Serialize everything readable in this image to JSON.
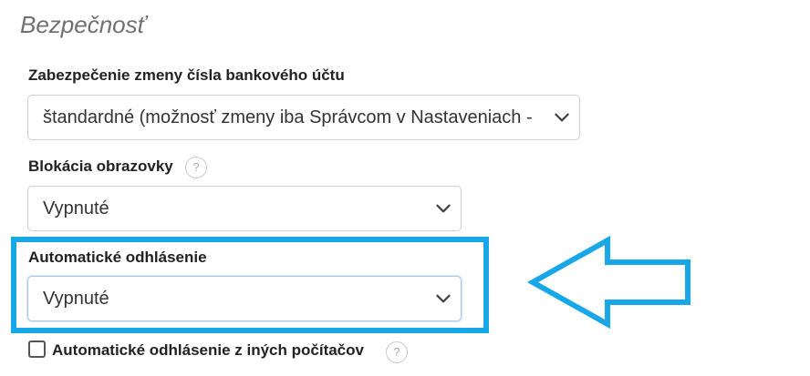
{
  "section": {
    "title": "Bezpečnosť"
  },
  "fields": {
    "bank_account_change": {
      "label": "Zabezpečenie zmeny čísla bankového účtu",
      "value": "štandardné (možnosť zmeny iba Správcom v Nastaveniach - "
    },
    "screen_lock": {
      "label": "Blokácia obrazovky",
      "value": "Vypnuté",
      "help": "?"
    },
    "auto_logout": {
      "label": "Automatické odhlásenie",
      "value": "Vypnuté"
    },
    "auto_logout_other": {
      "label": "Automatické odhlásenie z iných počítačov",
      "help": "?",
      "checked": false
    }
  },
  "icons": {
    "chevron": "chevron-down-icon",
    "help": "question-circle-icon",
    "arrow": "left-arrow-callout-icon"
  },
  "colors": {
    "highlight": "#1aa7e8",
    "title": "#707070",
    "text": "#222222"
  }
}
